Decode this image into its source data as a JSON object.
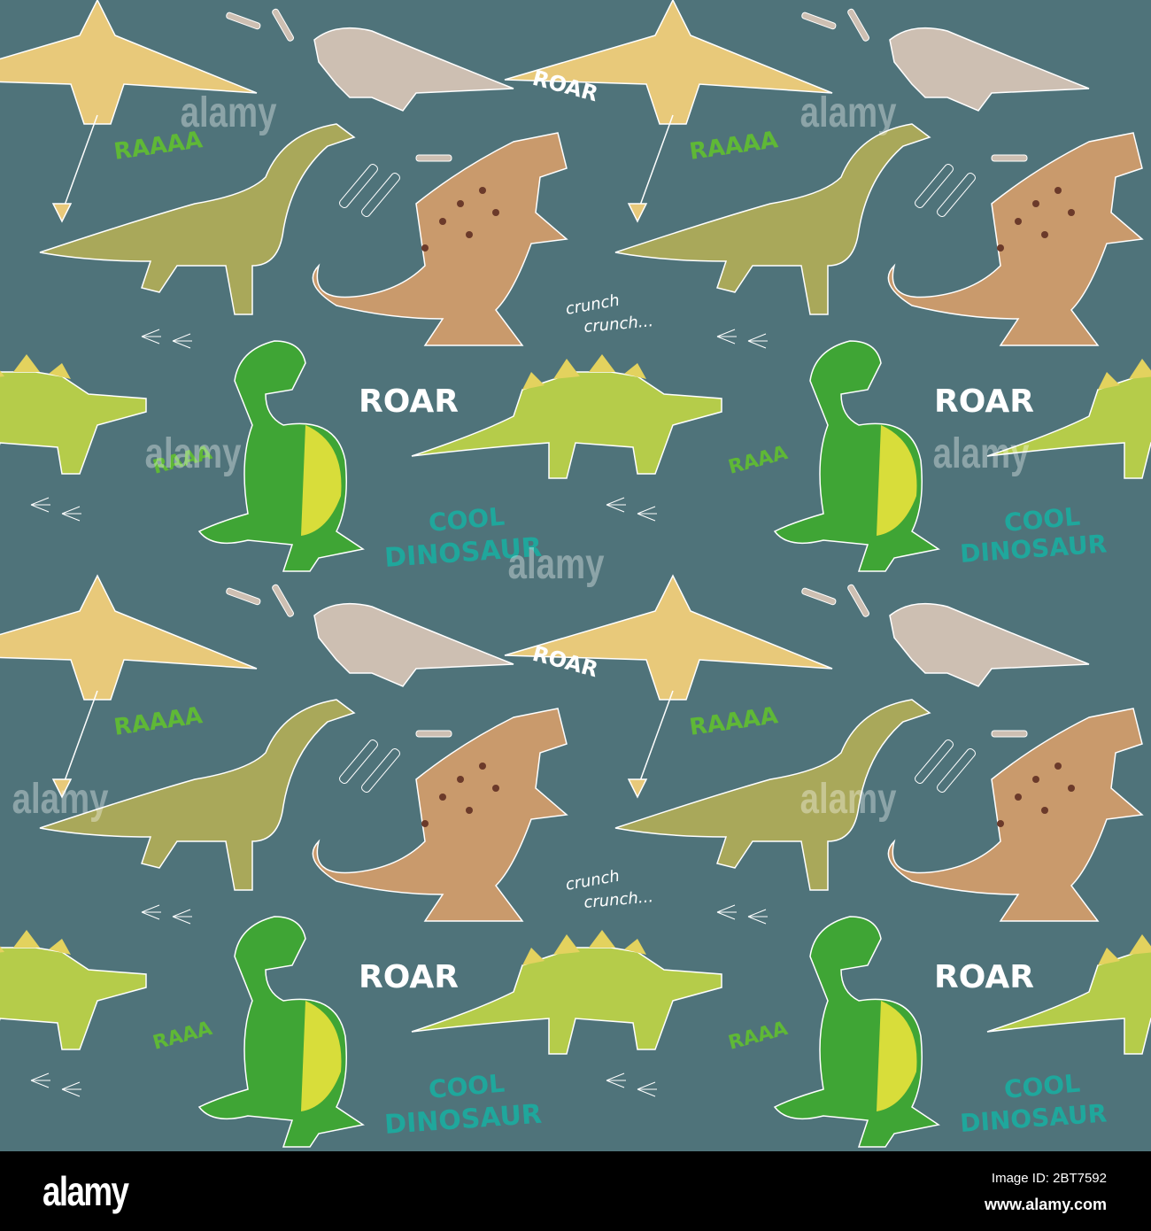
{
  "texts": {
    "roar": "ROAR",
    "raaaa": "RAAAA",
    "raaa": "RAAA",
    "crunch1": "crunch",
    "crunch2": "crunch...",
    "cool": "COOL",
    "dinosaur": "DINOSAUR"
  },
  "watermark": "alamy",
  "footer": {
    "logo": "alamy",
    "image_id": "Image ID: 2BT7592",
    "site": "www.alamy.com"
  },
  "colors": {
    "background": "#4f737a",
    "pterodactyl": "#e8c97a",
    "protoceratops": "#cdbfb2",
    "brachiosaurus": "#a9a85a",
    "theropod": "#c99a6c",
    "stegosaurus": "#b5cc4a",
    "trex": "#3fa535",
    "green_text": "#5fb836",
    "teal_text": "#1fa79c"
  }
}
